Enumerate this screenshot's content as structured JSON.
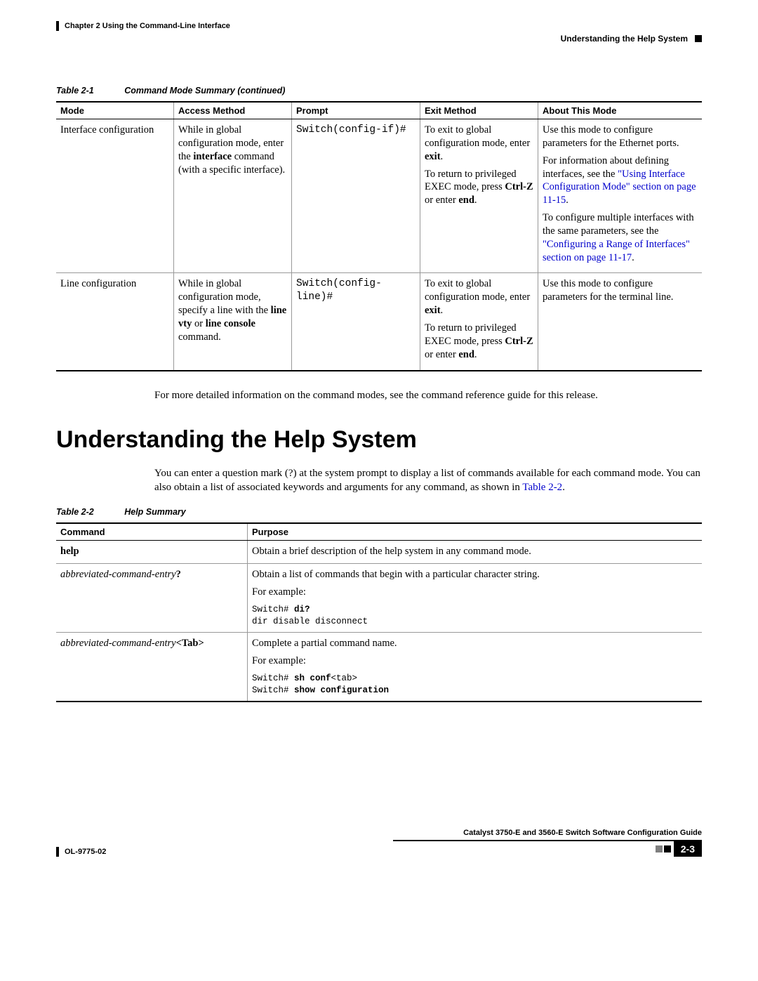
{
  "header": {
    "chapter": "Chapter 2      Using the Command-Line Interface",
    "section": "Understanding the Help System"
  },
  "table1": {
    "caption_label": "Table 2-1",
    "caption_title": "Command Mode Summary (continued)",
    "columns": {
      "mode": "Mode",
      "access": "Access Method",
      "prompt": "Prompt",
      "exit": "Exit Method",
      "about": "About This Mode"
    },
    "rows": {
      "r1": {
        "mode": "Interface configuration",
        "access_p1": "While in global configuration mode, enter the ",
        "access_bold": "interface",
        "access_p2": " command (with a specific interface).",
        "prompt": "Switch(config-if)#",
        "exit_p1": "To exit to global configuration mode, enter ",
        "exit_b1": "exit",
        "exit_p1b": ".",
        "exit_p2": "To return to privileged EXEC mode, press ",
        "exit_b2": "Ctrl-Z",
        "exit_p2b": " or enter ",
        "exit_b3": "end",
        "exit_p2c": ".",
        "about_p1": "Use this mode to configure parameters for the Ethernet ports.",
        "about_p2a": "For information about defining interfaces, see the ",
        "about_link1": "\"Using Interface Configuration Mode\" section on page 11-15",
        "about_p2b": ".",
        "about_p3a": "To configure multiple interfaces with the same parameters, see the ",
        "about_link2": "\"Configuring a Range of Interfaces\" section on page 11-17",
        "about_p3b": "."
      },
      "r2": {
        "mode": "Line configuration",
        "access_p1": "While in global configuration mode, specify a line with the ",
        "access_b1": "line vty",
        "access_p2": " or ",
        "access_b2": "line console",
        "access_p3": " command.",
        "prompt": "Switch(config-line)#",
        "exit_p1": "To exit to global configuration mode, enter ",
        "exit_b1": "exit",
        "exit_p1b": ".",
        "exit_p2": "To return to privileged EXEC mode, press ",
        "exit_b2": "Ctrl-Z",
        "exit_p2b": " or enter ",
        "exit_b3": "end",
        "exit_p2c": ".",
        "about": "Use this mode to configure parameters for the terminal line."
      }
    }
  },
  "body": {
    "para1": "For more detailed information on the command modes, see the command reference guide for this release.",
    "heading": "Understanding the Help System",
    "para2a": "You can enter a question mark (?) at the system prompt to display a list of commands available for each command mode. You can also obtain a list of associated keywords and arguments for any command, as shown in ",
    "para2link": "Table 2-2",
    "para2b": "."
  },
  "table2": {
    "caption_label": "Table 2-2",
    "caption_title": "Help Summary",
    "columns": {
      "command": "Command",
      "purpose": "Purpose"
    },
    "rows": {
      "r1": {
        "cmd": "help",
        "purpose": "Obtain a brief description of the help system in any command mode."
      },
      "r2": {
        "cmd_ital": "abbreviated-command-entry",
        "cmd_bold": "?",
        "purpose_p1": "Obtain a list of commands that begin with a particular character string.",
        "purpose_p2": "For example:",
        "code1a": "Switch# ",
        "code1b": "di?",
        "code2": "dir disable disconnect"
      },
      "r3": {
        "cmd_ital": "abbreviated-command-entry",
        "cmd_bold": "<Tab>",
        "purpose_p1": "Complete a partial command name.",
        "purpose_p2": "For example:",
        "code1a": "Switch# ",
        "code1b": "sh conf",
        "code1c": "<tab>",
        "code2a": "Switch# ",
        "code2b": "show configuration"
      }
    }
  },
  "footer": {
    "docid": "OL-9775-02",
    "guide": "Catalyst 3750-E and 3560-E Switch Software Configuration Guide",
    "pagenum": "2-3"
  }
}
